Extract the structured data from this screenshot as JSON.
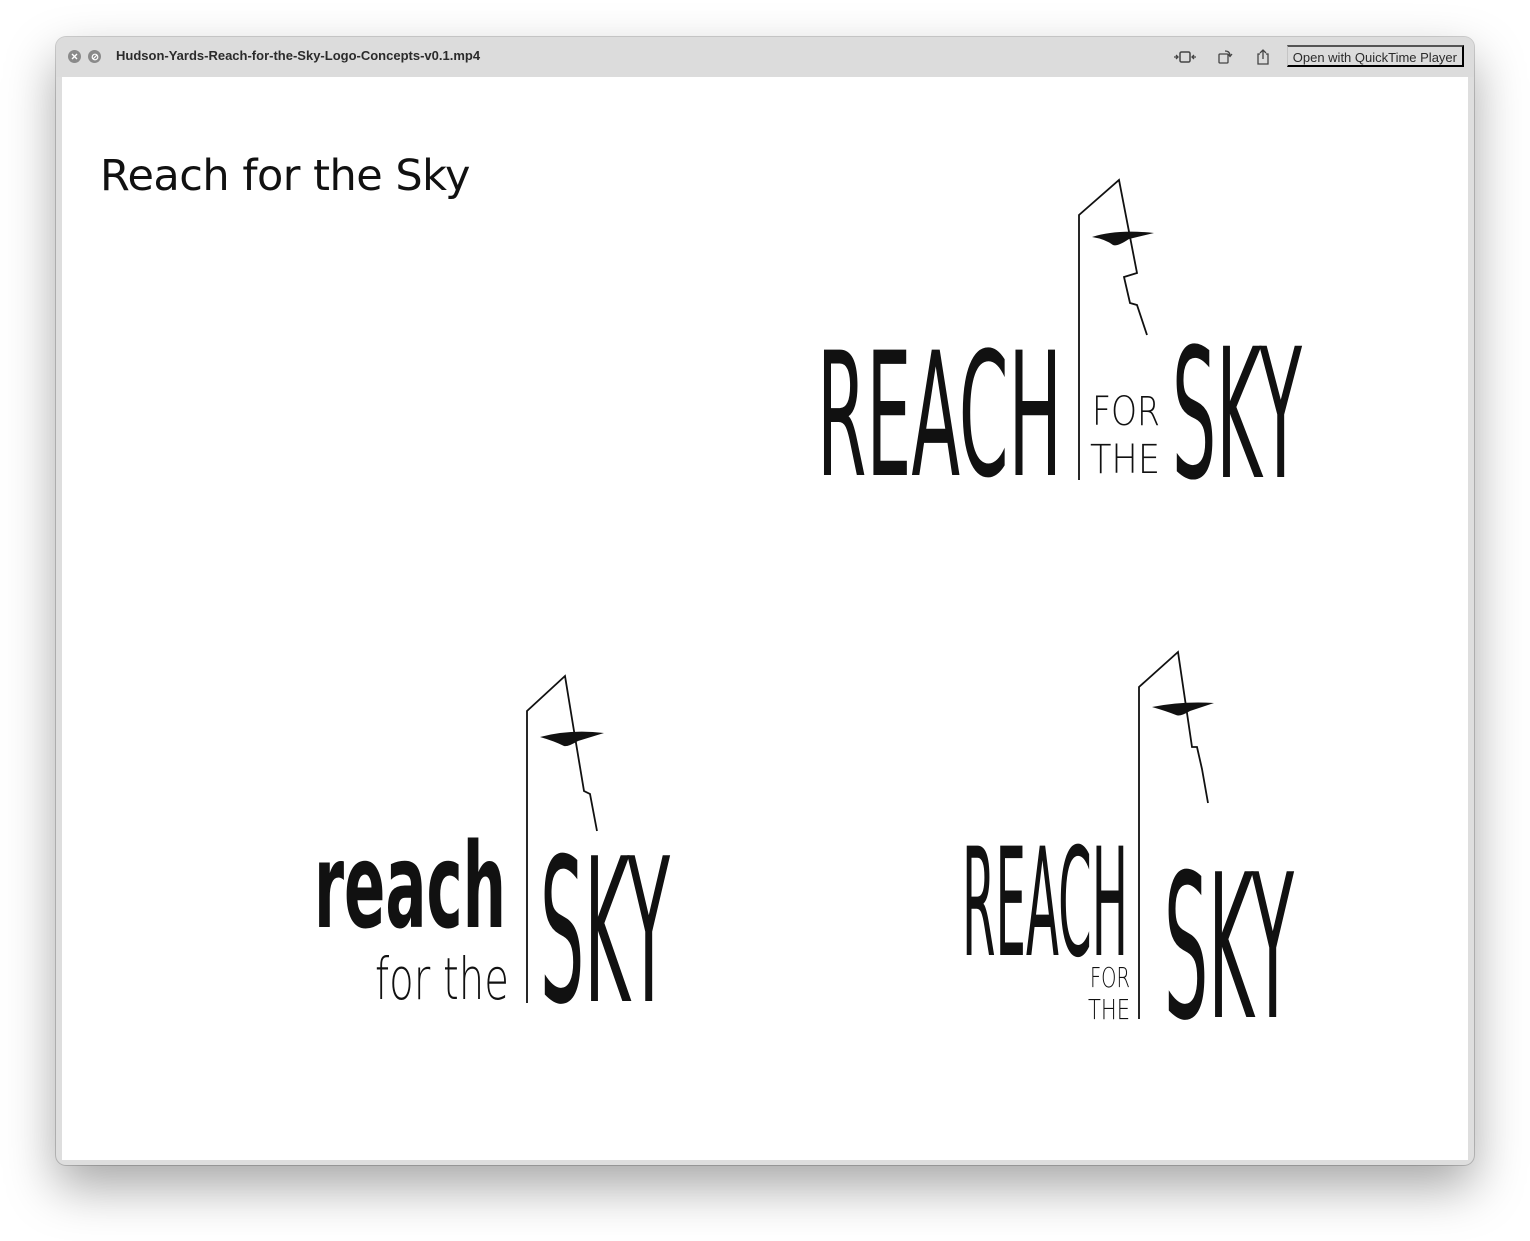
{
  "window": {
    "title": "Hudson-Yards-Reach-for-the-Sky-Logo-Concepts-v0.1.mp4",
    "open_button_label": "Open with QuickTime Player",
    "icons": [
      "close-icon",
      "hide-icon",
      "trim-icon",
      "rotate-icon",
      "share-icon"
    ]
  },
  "slide": {
    "title": "Reach for the Sky",
    "logos": [
      {
        "word_main": "REACH",
        "word_small_1": "FOR",
        "word_small_2": "THE",
        "word_big": "SKY"
      },
      {
        "word_main": "reach",
        "word_small_1": "for the",
        "word_big": "SKY"
      },
      {
        "word_main": "REACH",
        "word_small_1": "FOR",
        "word_small_2": "THE",
        "word_big": "SKY"
      }
    ]
  }
}
